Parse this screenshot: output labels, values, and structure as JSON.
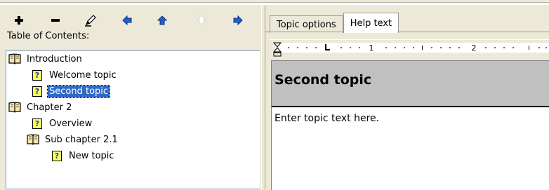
{
  "toolbar": {
    "buttons": [
      {
        "name": "add-button",
        "icon": "plus-icon"
      },
      {
        "name": "remove-button",
        "icon": "minus-icon"
      },
      {
        "name": "rename-button",
        "icon": "pencil-icon"
      },
      {
        "name": "move-left-button",
        "icon": "arrow-left-icon"
      },
      {
        "name": "move-up-button",
        "icon": "arrow-up-icon"
      },
      {
        "name": "move-down-button",
        "icon": "arrow-down-icon",
        "disabled": true
      },
      {
        "name": "move-right-button",
        "icon": "arrow-right-icon"
      }
    ]
  },
  "toc": {
    "label": "Table of Contents:",
    "items": [
      {
        "label": "Introduction",
        "type": "book"
      },
      {
        "label": "Welcome topic",
        "type": "topic"
      },
      {
        "label": "Second topic",
        "type": "topic",
        "selected": true
      },
      {
        "label": "Chapter 2",
        "type": "book"
      },
      {
        "label": "Overview",
        "type": "topic"
      },
      {
        "label": "Sub chapter 2.1",
        "type": "book"
      },
      {
        "label": "New topic",
        "type": "topic"
      }
    ]
  },
  "tabs": [
    {
      "label": "Topic options",
      "active": false
    },
    {
      "label": "Help text",
      "active": true
    }
  ],
  "ruler": {
    "marks": [
      "1",
      "2"
    ]
  },
  "editor": {
    "heading": "Second topic",
    "body": "Enter topic text here."
  },
  "colors": {
    "selection": "#316ac5",
    "heading_band": "#c0c0c0",
    "window_bg": "#ece9d8"
  }
}
